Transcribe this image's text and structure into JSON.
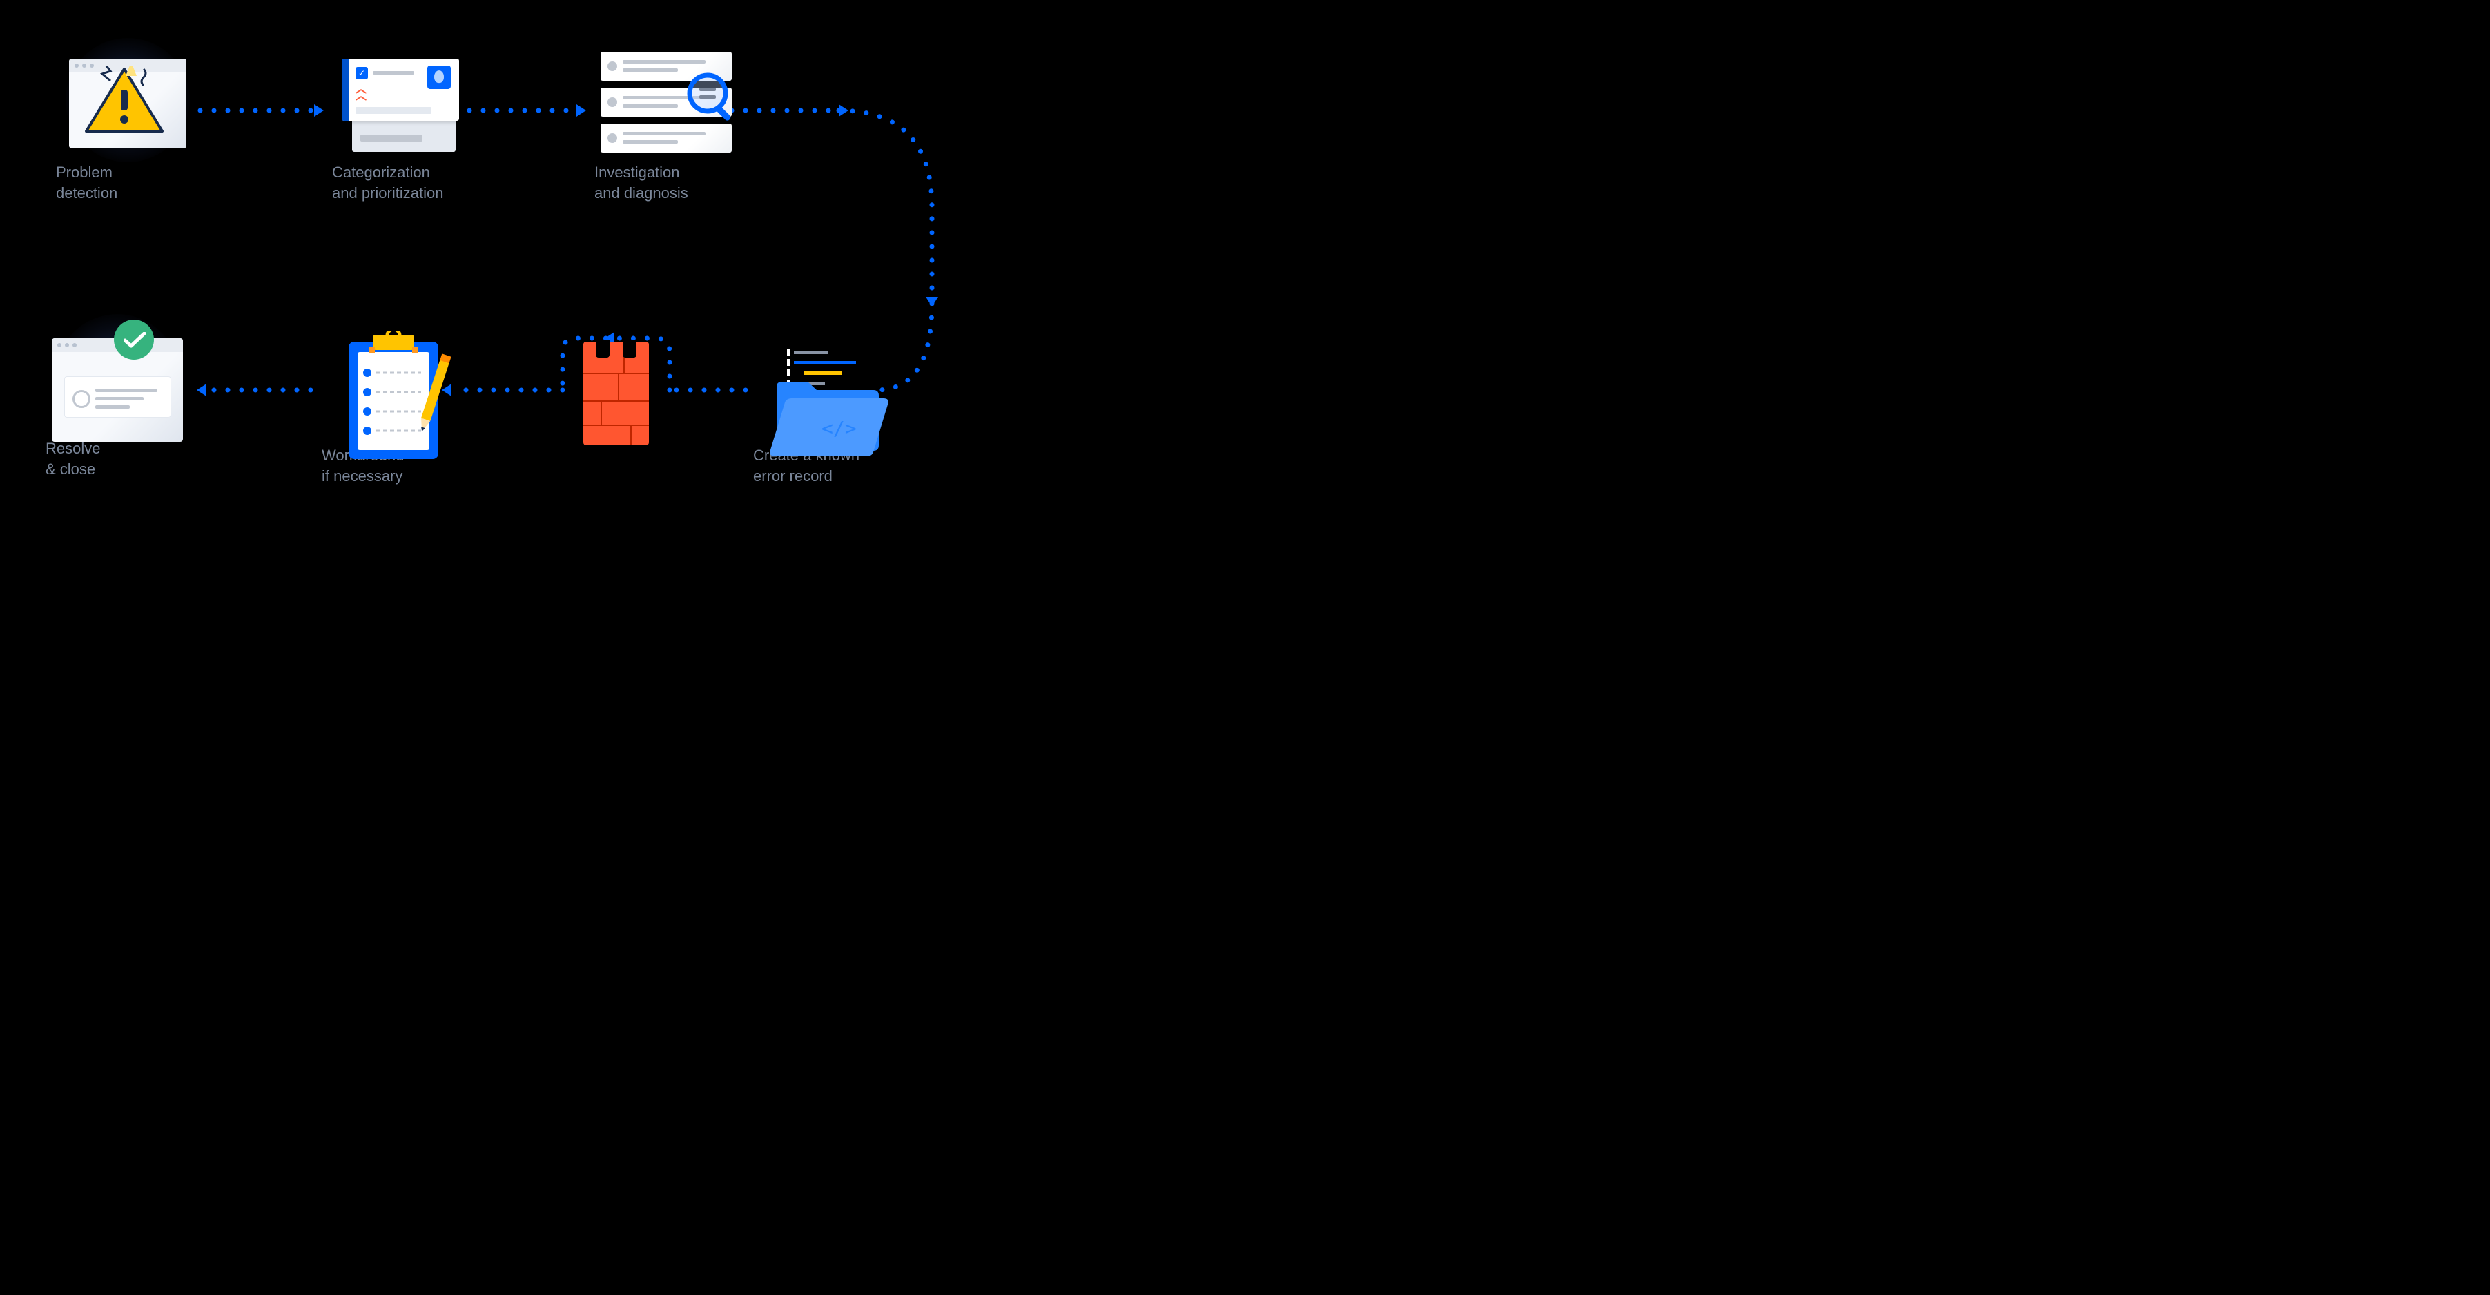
{
  "steps": {
    "s1": {
      "label_line1": "Problem",
      "label_line2": "detection"
    },
    "s2": {
      "label_line1": "Categorization",
      "label_line2": "and prioritization"
    },
    "s3": {
      "label_line1": "Investigation",
      "label_line2": "and diagnosis"
    },
    "s5": {
      "label_line1": "Create a known",
      "label_line2": "error record"
    },
    "s7": {
      "label_line1": "Workaround",
      "label_line2": "if necessary"
    },
    "s8": {
      "label_line1": "Resolve",
      "label_line2": "& close"
    }
  }
}
